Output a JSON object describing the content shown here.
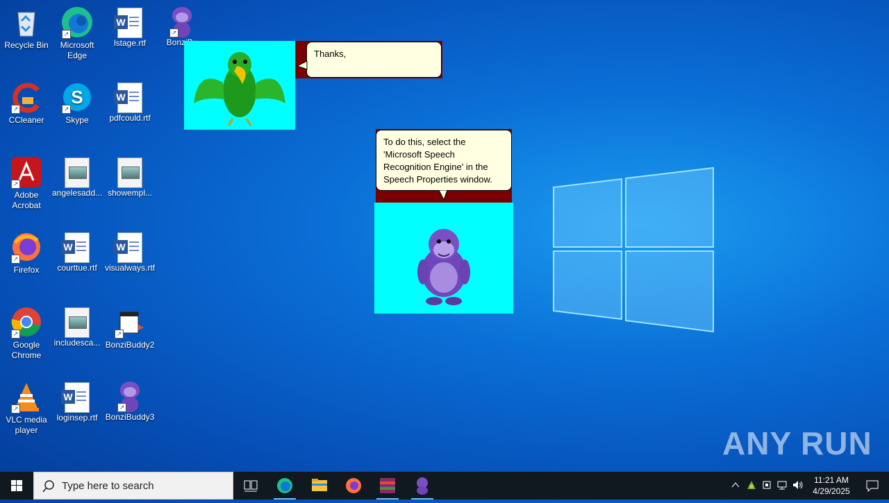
{
  "desktop": {
    "icons": [
      {
        "label": "Recycle Bin"
      },
      {
        "label": "Microsoft Edge"
      },
      {
        "label": "lstage.rtf"
      },
      {
        "label": "BonziBu"
      },
      {
        "label": "CCleaner"
      },
      {
        "label": "Skype"
      },
      {
        "label": "pdfcould.rtf"
      },
      {
        "label": "Adobe Acrobat"
      },
      {
        "label": "angelesadd..."
      },
      {
        "label": "showempl..."
      },
      {
        "label": "Firefox"
      },
      {
        "label": "courttue.rtf"
      },
      {
        "label": "visualways.rtf"
      },
      {
        "label": "Google Chrome"
      },
      {
        "label": "includesca..."
      },
      {
        "label": "BonziBuddy2"
      },
      {
        "label": "VLC media player"
      },
      {
        "label": "loginsep.rtf"
      },
      {
        "label": "BonziBuddy3"
      }
    ]
  },
  "agents": {
    "parrot_bubble": "Thanks,",
    "bonzi_bubble": "To do this, select the 'Microsoft Speech Recognition Engine' in the Speech Properties window."
  },
  "taskbar": {
    "search_placeholder": "Type here to search",
    "time": "11:21 AM",
    "date": "4/29/2025"
  },
  "watermark": "ANY RUN",
  "colors": {
    "agent_bg": "#00ffff",
    "bubble_bg": "#ffffe1",
    "maroon": "#7a0000",
    "taskbar": "#101820"
  }
}
